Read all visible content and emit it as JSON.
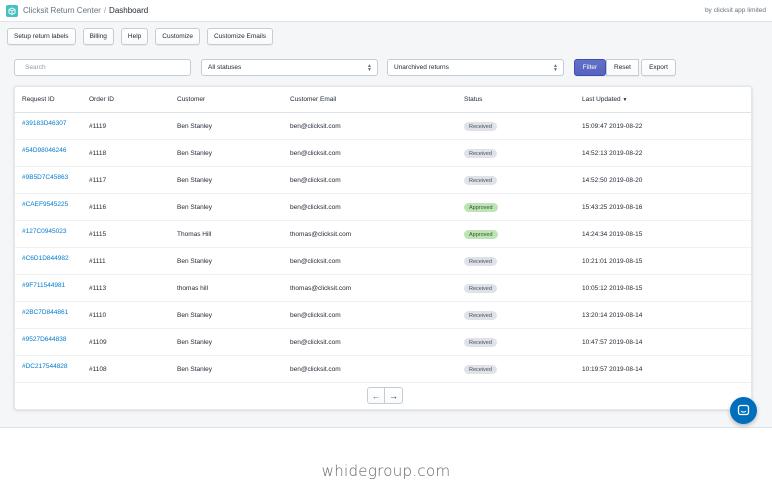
{
  "header": {
    "app_name": "Clicksit Return Center",
    "separator": "/",
    "page": "Dashboard",
    "company": "by clicksit app limited"
  },
  "toolbar": [
    {
      "label": "Setup return labels"
    },
    {
      "label": "Billing"
    },
    {
      "label": "Help"
    },
    {
      "label": "Customize"
    },
    {
      "label": "Customize Emails"
    }
  ],
  "filters": {
    "search_placeholder": "Search",
    "status_select": "All statuses",
    "archive_select": "Unarchived returns",
    "filter_label": "Filter",
    "reset_label": "Reset",
    "export_label": "Export"
  },
  "table": {
    "columns": {
      "request_id": "Request ID",
      "order_id": "Order ID",
      "customer": "Customer",
      "email": "Customer Email",
      "status": "Status",
      "updated": "Last Updated"
    },
    "rows": [
      {
        "request_id": "#39183D46307",
        "order_id": "#1119",
        "customer": "Ben Stanley",
        "email": "ben@clicksit.com",
        "status": "Received",
        "updated": "15:09:47 2019-08-22"
      },
      {
        "request_id": "#54D98046246",
        "order_id": "#1118",
        "customer": "Ben Stanley",
        "email": "ben@clicksit.com",
        "status": "Received",
        "updated": "14:52:13 2019-08-22"
      },
      {
        "request_id": "#9B5D7C45863",
        "order_id": "#1117",
        "customer": "Ben Stanley",
        "email": "ben@clicksit.com",
        "status": "Received",
        "updated": "14:52:50 2019-08-20"
      },
      {
        "request_id": "#CAEF9545225",
        "order_id": "#1116",
        "customer": "Ben Stanley",
        "email": "ben@clicksit.com",
        "status": "Approved",
        "updated": "15:43:25 2019-08-16"
      },
      {
        "request_id": "#127C0945023",
        "order_id": "#1115",
        "customer": "Thomas Hill",
        "email": "thomas@clicksit.com",
        "status": "Approved",
        "updated": "14:24:34 2019-08-15"
      },
      {
        "request_id": "#C6D1D844982",
        "order_id": "#1111",
        "customer": "Ben Stanley",
        "email": "ben@clicksit.com",
        "status": "Received",
        "updated": "10:21:01 2019-08-15"
      },
      {
        "request_id": "#9F711544981",
        "order_id": "#1113",
        "customer": "thomas hill",
        "email": "thomas@clicksit.com",
        "status": "Received",
        "updated": "10:05:12 2019-08-15"
      },
      {
        "request_id": "#2BC7D844861",
        "order_id": "#1110",
        "customer": "Ben Stanley",
        "email": "ben@clicksit.com",
        "status": "Received",
        "updated": "13:20:14 2019-08-14"
      },
      {
        "request_id": "#9527D644838",
        "order_id": "#1109",
        "customer": "Ben Stanley",
        "email": "ben@clicksit.com",
        "status": "Received",
        "updated": "10:47:57 2019-08-14"
      },
      {
        "request_id": "#DC217544828",
        "order_id": "#1108",
        "customer": "Ben Stanley",
        "email": "ben@clicksit.com",
        "status": "Received",
        "updated": "10:19:57 2019-08-14"
      }
    ],
    "status_colors": {
      "Received": {
        "bg": "#dfe3e8",
        "fg": "#454f5b"
      },
      "Approved": {
        "bg": "#bbe5b3",
        "fg": "#414f3e"
      }
    }
  },
  "pagination": {
    "prev_icon": "arrow-left-icon",
    "next_icon": "arrow-right-icon",
    "prev_glyph": "←",
    "next_glyph": "→"
  },
  "chat": {
    "icon": "chat-bubble-icon"
  },
  "watermark": "whidegroup.com",
  "colors": {
    "link": "#007ace",
    "primary": "#5c6ac4",
    "chat": "#006fbb",
    "logo": "#47c1bf"
  }
}
